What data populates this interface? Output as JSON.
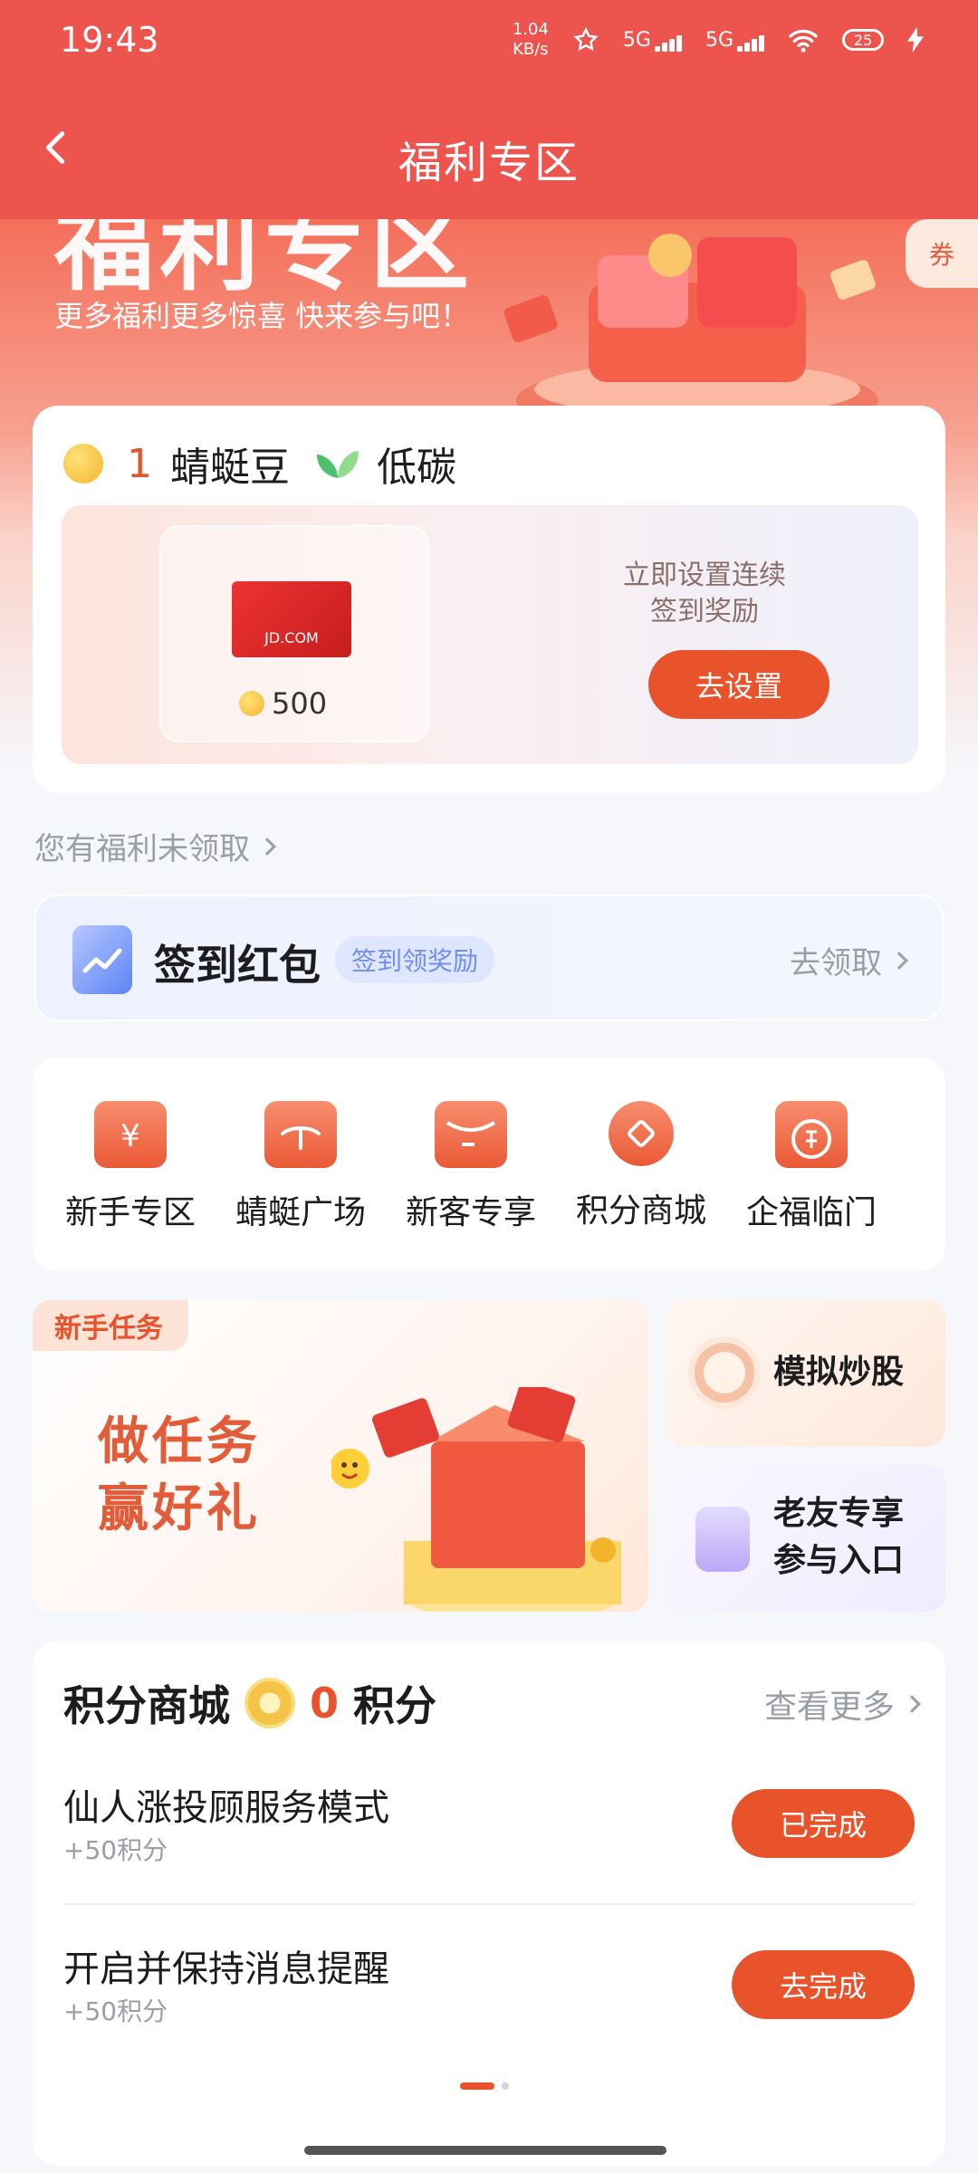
{
  "status_bar": {
    "time": "19:43",
    "speed_value": "1.04",
    "speed_unit": "KB/s",
    "sim1": "5G",
    "sim2": "5G",
    "battery": "25"
  },
  "header": {
    "title": "福利专区"
  },
  "hero": {
    "big_title": "福利专区",
    "subtitle": "更多福利更多惊喜 快来参与吧！",
    "coupon_tab": "券"
  },
  "beans": {
    "count": "1",
    "label": "蜻蜓豆",
    "lowcarbon_label": "低碳",
    "reward_card_text": "JD.COM",
    "reward_value": "500",
    "setup_text_line1": "立即设置连续",
    "setup_text_line2": "签到奖励",
    "setup_button": "去设置"
  },
  "unclaimed_link": "您有福利未领取",
  "signin_packet": {
    "label": "签到红包",
    "tag": "签到领奖励",
    "action": "去领取"
  },
  "quick_entries": [
    {
      "label": "新手专区",
      "icon": "yen-bag-icon"
    },
    {
      "label": "蜻蜓广场",
      "icon": "dragonfly-envelope-icon"
    },
    {
      "label": "新客专享",
      "icon": "red-packet-icon"
    },
    {
      "label": "积分商城",
      "icon": "coin-icon"
    },
    {
      "label": "企福临门",
      "icon": "fu-door-icon"
    }
  ],
  "task_banner": {
    "ribbon": "新手任务",
    "line1": "做任务",
    "line2": "赢好礼"
  },
  "side_cards": {
    "card1": "模拟炒股",
    "card2_line1": "老友专享",
    "card2_line2": "参与入口"
  },
  "points_mall": {
    "title": "积分商城",
    "points": "0",
    "points_unit": "积分",
    "more": "查看更多",
    "tasks": [
      {
        "title": "仙人涨投顾服务模式",
        "reward": "+50积分",
        "button": "已完成"
      },
      {
        "title": "开启并保持消息提醒",
        "reward": "+50积分",
        "button": "去完成"
      }
    ]
  },
  "colors": {
    "brand_red": "#ec544d",
    "accent_orange": "#e8532b",
    "muted_text": "#9a9ea8"
  }
}
